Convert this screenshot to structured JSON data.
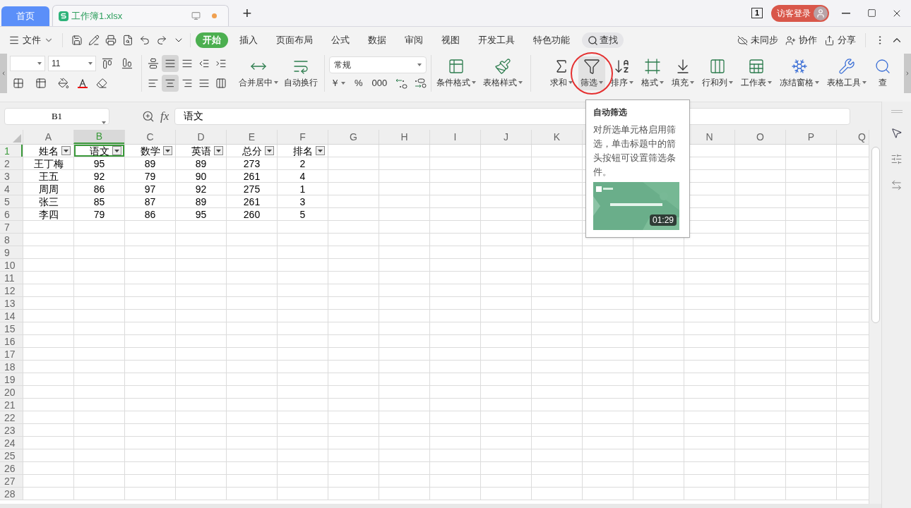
{
  "tabs": [
    {
      "label": "首页",
      "kind": "home",
      "selected": false
    },
    {
      "label": "工作簿1.xlsx",
      "kind": "document",
      "selected": true,
      "unsaved": true
    }
  ],
  "new_tab": "+",
  "window_badge": "1",
  "account": {
    "label": "访客登录"
  },
  "menu": {
    "file": "文件",
    "ribbon_tabs": [
      {
        "label": "开始",
        "selected": true
      },
      {
        "label": "插入",
        "selected": false
      },
      {
        "label": "页面布局",
        "selected": false
      },
      {
        "label": "公式",
        "selected": false
      },
      {
        "label": "数据",
        "selected": false
      },
      {
        "label": "审阅",
        "selected": false
      },
      {
        "label": "视图",
        "selected": false
      },
      {
        "label": "开发工具",
        "selected": false
      },
      {
        "label": "特色功能",
        "selected": false
      }
    ],
    "search": "查找",
    "actions": [
      "未同步",
      "协作",
      "分享"
    ]
  },
  "ribbon": {
    "font_size": "11",
    "number_format": "常规",
    "number_buttons": [
      "￥",
      "%",
      "000"
    ],
    "format_buttons": [
      {
        "label": "合并居中",
        "dropdown": true
      },
      {
        "label": "自动换行",
        "dropdown": false
      }
    ],
    "style_buttons": [
      {
        "label": "条件格式",
        "dropdown": true
      },
      {
        "label": "表格样式",
        "dropdown": true
      }
    ],
    "tools": [
      {
        "label": "求和",
        "dropdown": true,
        "hovered": false,
        "circled": false
      },
      {
        "label": "筛选",
        "dropdown": true,
        "hovered": true,
        "circled": true
      },
      {
        "label": "排序",
        "dropdown": true,
        "hovered": false,
        "circled": false
      },
      {
        "label": "格式",
        "dropdown": true,
        "hovered": false,
        "circled": false
      },
      {
        "label": "填充",
        "dropdown": true,
        "hovered": false,
        "circled": false
      },
      {
        "label": "行和列",
        "dropdown": true,
        "hovered": false,
        "circled": false
      },
      {
        "label": "工作表",
        "dropdown": true,
        "hovered": false,
        "circled": false
      },
      {
        "label": "冻结窗格",
        "dropdown": true,
        "hovered": false,
        "circled": false
      },
      {
        "label": "表格工具",
        "dropdown": true,
        "hovered": false,
        "circled": false
      },
      {
        "label": "查",
        "dropdown": false,
        "hovered": false,
        "circled": false
      }
    ]
  },
  "formula_bar": {
    "cell": "B1",
    "fx": "fx",
    "value": "语文"
  },
  "sheet": {
    "columns": [
      {
        "label": "A",
        "selected": false
      },
      {
        "label": "B",
        "selected": true
      },
      {
        "label": "C",
        "selected": false
      },
      {
        "label": "D",
        "selected": false
      },
      {
        "label": "E",
        "selected": false
      },
      {
        "label": "F",
        "selected": false
      },
      {
        "label": "G",
        "selected": false
      },
      {
        "label": "H",
        "selected": false
      },
      {
        "label": "I",
        "selected": false
      },
      {
        "label": "J",
        "selected": false
      },
      {
        "label": "K",
        "selected": false
      },
      {},
      {},
      {
        "label": "N",
        "selected": false
      },
      {
        "label": "O",
        "selected": false
      },
      {
        "label": "P",
        "selected": false
      },
      {
        "label": "Q",
        "selected": false
      }
    ],
    "rows": [
      {
        "number": "1",
        "selected": true,
        "cells": [
          {
            "text": "姓名",
            "filter": true,
            "selected": false
          },
          {
            "text": "语文",
            "filter": true,
            "selected": true
          },
          {
            "text": "数学",
            "filter": true,
            "selected": false
          },
          {
            "text": "英语",
            "filter": true,
            "selected": false
          },
          {
            "text": "总分",
            "filter": true,
            "selected": false
          },
          {
            "text": "排名",
            "filter": true,
            "selected": false
          }
        ]
      },
      {
        "number": "2",
        "selected": false,
        "cells": [
          {
            "text": "王丁梅",
            "filter": false,
            "selected": false
          },
          {
            "text": "95",
            "filter": false,
            "selected": false
          },
          {
            "text": "89",
            "filter": false,
            "selected": false
          },
          {
            "text": "89",
            "filter": false,
            "selected": false
          },
          {
            "text": "273",
            "filter": false,
            "selected": false
          },
          {
            "text": "2",
            "filter": false,
            "selected": false
          }
        ]
      },
      {
        "number": "3",
        "selected": false,
        "cells": [
          {
            "text": "王五",
            "filter": false,
            "selected": false
          },
          {
            "text": "92",
            "filter": false,
            "selected": false
          },
          {
            "text": "79",
            "filter": false,
            "selected": false
          },
          {
            "text": "90",
            "filter": false,
            "selected": false
          },
          {
            "text": "261",
            "filter": false,
            "selected": false
          },
          {
            "text": "4",
            "filter": false,
            "selected": false
          }
        ]
      },
      {
        "number": "4",
        "selected": false,
        "cells": [
          {
            "text": "周周",
            "filter": false,
            "selected": false
          },
          {
            "text": "86",
            "filter": false,
            "selected": false
          },
          {
            "text": "97",
            "filter": false,
            "selected": false
          },
          {
            "text": "92",
            "filter": false,
            "selected": false
          },
          {
            "text": "275",
            "filter": false,
            "selected": false
          },
          {
            "text": "1",
            "filter": false,
            "selected": false
          }
        ]
      },
      {
        "number": "5",
        "selected": false,
        "cells": [
          {
            "text": "张三",
            "filter": false,
            "selected": false
          },
          {
            "text": "85",
            "filter": false,
            "selected": false
          },
          {
            "text": "87",
            "filter": false,
            "selected": false
          },
          {
            "text": "89",
            "filter": false,
            "selected": false
          },
          {
            "text": "261",
            "filter": false,
            "selected": false
          },
          {
            "text": "3",
            "filter": false,
            "selected": false
          }
        ]
      },
      {
        "number": "6",
        "selected": false,
        "cells": [
          {
            "text": "李四",
            "filter": false,
            "selected": false
          },
          {
            "text": "79",
            "filter": false,
            "selected": false
          },
          {
            "text": "86",
            "filter": false,
            "selected": false
          },
          {
            "text": "95",
            "filter": false,
            "selected": false
          },
          {
            "text": "260",
            "filter": false,
            "selected": false
          },
          {
            "text": "5",
            "filter": false,
            "selected": false
          }
        ]
      },
      {
        "number": "7",
        "selected": false
      },
      {
        "number": "8",
        "selected": false
      },
      {
        "number": "9",
        "selected": false
      },
      {
        "number": "10",
        "selected": false
      },
      {
        "number": "11",
        "selected": false
      },
      {
        "number": "12",
        "selected": false
      },
      {
        "number": "13",
        "selected": false
      },
      {
        "number": "14",
        "selected": false
      },
      {
        "number": "15",
        "selected": false
      },
      {
        "number": "16",
        "selected": false
      },
      {
        "number": "17",
        "selected": false
      },
      {
        "number": "18",
        "selected": false
      },
      {
        "number": "19",
        "selected": false
      },
      {
        "number": "20",
        "selected": false
      },
      {
        "number": "21",
        "selected": false
      },
      {
        "number": "22",
        "selected": false
      },
      {
        "number": "23",
        "selected": false
      },
      {
        "number": "24",
        "selected": false
      },
      {
        "number": "25",
        "selected": false
      },
      {
        "number": "26",
        "selected": false
      },
      {
        "number": "27",
        "selected": false
      },
      {
        "number": "28",
        "selected": false
      }
    ]
  },
  "tooltip": {
    "title": "自动筛选",
    "text": "对所选单元格启用筛选，单击标题中的箭头按钮可设置筛选条件。",
    "video": {
      "kind": "picture",
      "duration": "01:29"
    }
  }
}
